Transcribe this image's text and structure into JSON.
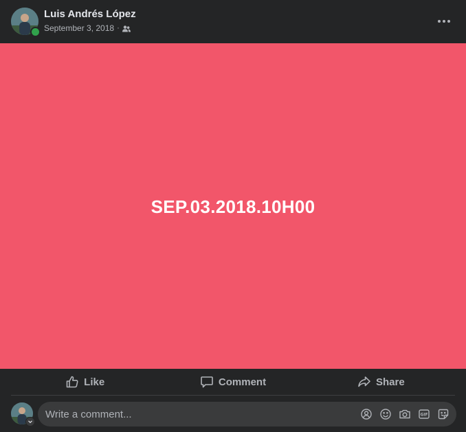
{
  "post": {
    "author": "Luis Andrés López",
    "date": "September 3, 2018",
    "separator": "·",
    "audience_icon": "friends-icon",
    "more_icon": "more-horizontal-icon",
    "media_text": "SEP.03.2018.10H00",
    "media_background": "#f2566a"
  },
  "actions": {
    "like_label": "Like",
    "comment_label": "Comment",
    "share_label": "Share"
  },
  "comment_composer": {
    "placeholder": "Write a comment...",
    "tools": [
      "avatar-sticker-icon",
      "emoji-icon",
      "camera-icon",
      "gif-icon",
      "sticker-icon"
    ]
  },
  "colors": {
    "card": "#242526",
    "secondary_text": "#b0b3b8",
    "online": "#31a24c"
  }
}
